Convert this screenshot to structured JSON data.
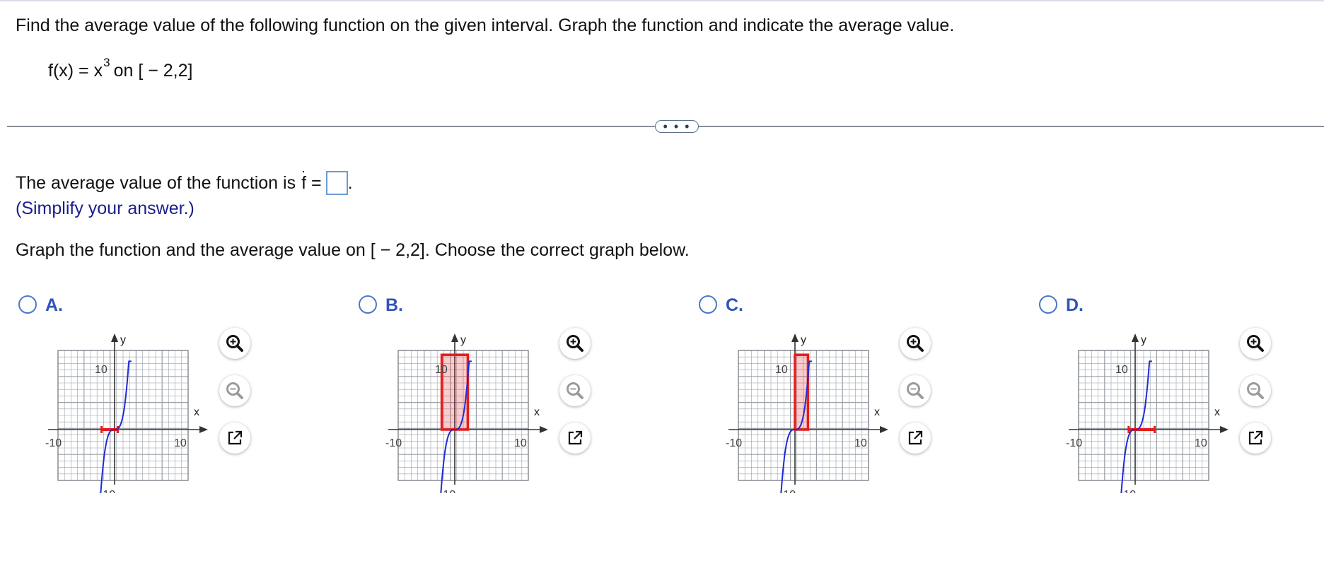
{
  "question": {
    "prompt": "Find the average value of the following function on the given interval. Graph the function and indicate the average value.",
    "function_lhs": "f(x) = x",
    "function_exponent": "3",
    "function_interval": "on [ − 2,2]"
  },
  "expand_button_label": "• • •",
  "answer": {
    "prefix": "The average value of the function is",
    "symbol": "f =",
    "value": "",
    "suffix": ".",
    "hint": "(Simplify your answer.)"
  },
  "graph_instruction": "Graph the function and the average value on [ − 2,2]. Choose the correct graph below.",
  "choices": [
    {
      "letter": "A.",
      "selected": false,
      "marker": "segment",
      "avg": 0
    },
    {
      "letter": "B.",
      "selected": false,
      "marker": "rect",
      "avg": 8,
      "rect_x": [
        -2,
        2
      ]
    },
    {
      "letter": "C.",
      "selected": false,
      "marker": "rect",
      "avg": 8,
      "rect_x": [
        0,
        2
      ]
    },
    {
      "letter": "D.",
      "selected": false,
      "marker": "segment",
      "avg": 0,
      "seg_x": [
        -1,
        3
      ]
    }
  ],
  "graph_labels": {
    "y": "y",
    "x": "x",
    "max": "10",
    "min": "-10",
    "xmax": "10",
    "xmin": "-10"
  },
  "graph_colors": {
    "curve": "#1f2bd6",
    "highlight": "#e51c1c",
    "grid": "#9aa0a6"
  },
  "tool_icons": [
    "zoom-in-icon",
    "zoom-out-icon",
    "open-external-icon"
  ]
}
